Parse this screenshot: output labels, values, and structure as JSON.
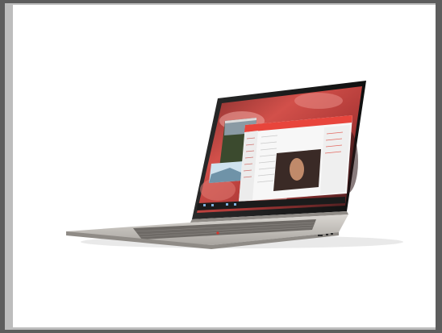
{
  "image": {
    "subject": "",
    "colors": {
      "outer_frame": "#5d5d5d",
      "inner_frame": "#bdbdbd",
      "background": "#ffffff",
      "bezel": "#111111",
      "chassis": "#c8c4bf",
      "wallpaper_red": "#c8403c",
      "app_accent": "#e8453c"
    }
  }
}
